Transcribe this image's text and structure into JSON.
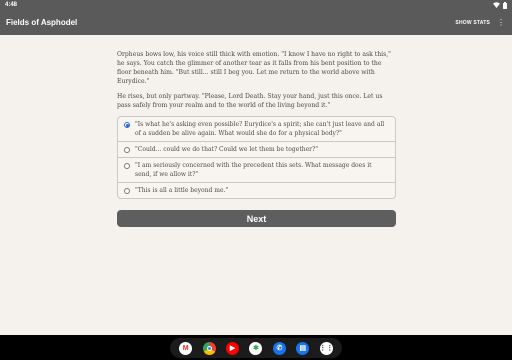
{
  "status_bar": {
    "time": "4:48",
    "wifi_icon": "wifi-icon",
    "battery_icon": "battery-icon"
  },
  "app_bar": {
    "title": "Fields of Asphodel",
    "show_stats_label": "SHOW STATS",
    "overflow_icon": "more-vert-icon"
  },
  "story": {
    "paragraphs": [
      "Orpheus bows low, his voice still thick with emotion. \"I know I have no right to ask this,\" he says. You catch the glimmer of another tear as it falls from his bent position to the floor beneath him. \"But still... still I beg you. Let me return to the world above with Eurydice.\"",
      "He rises, but only partway. \"Please, Lord Death. Stay your hand, just this once. Let us pass safely from your realm and to the world of the living beyond it.\""
    ]
  },
  "choices": [
    {
      "text": "\"Is what he's asking even possible? Eurydice's a spirit; she can't just leave and all of a sudden be alive again. What would she do for a physical body?\"",
      "selected": true
    },
    {
      "text": "\"Could... could we do that? Could we let them be together?\"",
      "selected": false
    },
    {
      "text": "\"I am seriously concerned with the precedent this sets. What message does it send, if we allow it?\"",
      "selected": false
    },
    {
      "text": "\"This is all a little beyond me.\"",
      "selected": false
    }
  ],
  "next_label": "Next",
  "taskbar": {
    "apps": [
      {
        "name": "gmail-icon",
        "glyph": "M",
        "bg": "#ffffff",
        "fg": "#d93025"
      },
      {
        "name": "chrome-icon",
        "glyph": "",
        "bg": "#ffffff",
        "fg": "#ffffff"
      },
      {
        "name": "youtube-icon",
        "glyph": "▶",
        "bg": "#ff0000",
        "fg": "#ffffff"
      },
      {
        "name": "photos-icon",
        "glyph": "✱",
        "bg": "#ffffff",
        "fg": "#34a853"
      },
      {
        "name": "phone-icon",
        "glyph": "✆",
        "bg": "#1a73e8",
        "fg": "#ffffff"
      },
      {
        "name": "messages-icon",
        "glyph": "▤",
        "bg": "#1a73e8",
        "fg": "#ffffff"
      },
      {
        "name": "app-drawer-icon",
        "glyph": "⋮⋮",
        "bg": "#ffffff",
        "fg": "#333333"
      }
    ]
  }
}
